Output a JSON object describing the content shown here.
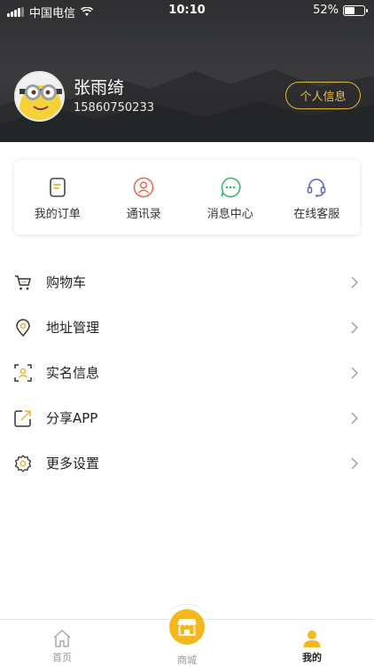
{
  "status_bar": {
    "carrier": "中国电信",
    "time": "10:10",
    "battery": "52%",
    "battery_level": 0.52
  },
  "profile": {
    "name": "张雨绮",
    "phone": "15860750233",
    "info_button": "个人信息"
  },
  "quick_actions": [
    {
      "label": "我的订单",
      "icon": "order-icon",
      "color": "#e7b434"
    },
    {
      "label": "通讯录",
      "icon": "contacts-icon",
      "color": "#e8694f"
    },
    {
      "label": "消息中心",
      "icon": "message-icon",
      "color": "#3bb86a"
    },
    {
      "label": "在线客服",
      "icon": "headset-icon",
      "color": "#5a66b7"
    }
  ],
  "menu": [
    {
      "label": "购物车",
      "icon": "cart-icon"
    },
    {
      "label": "地址管理",
      "icon": "location-pin-icon"
    },
    {
      "label": "实名信息",
      "icon": "id-card-icon"
    },
    {
      "label": "分享APP",
      "icon": "share-icon"
    },
    {
      "label": "更多设置",
      "icon": "settings-gear-icon"
    }
  ],
  "tabbar": {
    "home": "首页",
    "mall": "商城",
    "mine": "我的"
  },
  "colors": {
    "accent": "#f4b81c",
    "header_bg": "#333436"
  }
}
